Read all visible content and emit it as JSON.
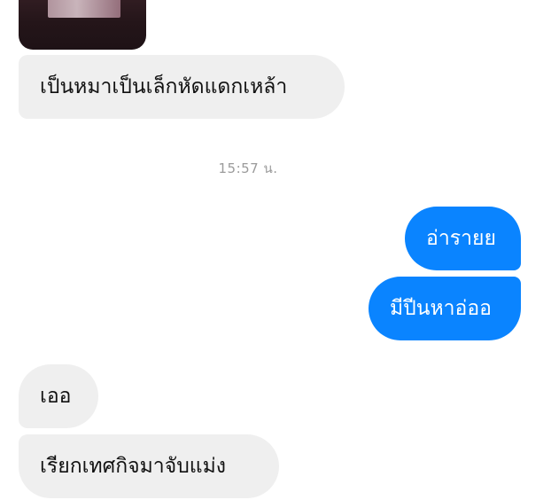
{
  "messages": [
    {
      "id": "m1",
      "direction": "incoming",
      "text": "เป็นหมาเป็นเล็กหัดแดกเหล้า"
    },
    {
      "id": "m2",
      "direction": "outgoing",
      "text": "อ่ารายย"
    },
    {
      "id": "m3",
      "direction": "outgoing",
      "text": "มีปีนหาอ่ออ"
    },
    {
      "id": "m4",
      "direction": "incoming",
      "text": "เออ"
    },
    {
      "id": "m5",
      "direction": "incoming",
      "text": "เรียกเทศกิจมาจับแม่ง"
    }
  ],
  "timestamp": "15:57 น.",
  "colors": {
    "outgoing_bubble": "#0a84ff",
    "incoming_bubble": "#efefef",
    "timestamp_text": "#9b9b9b"
  }
}
